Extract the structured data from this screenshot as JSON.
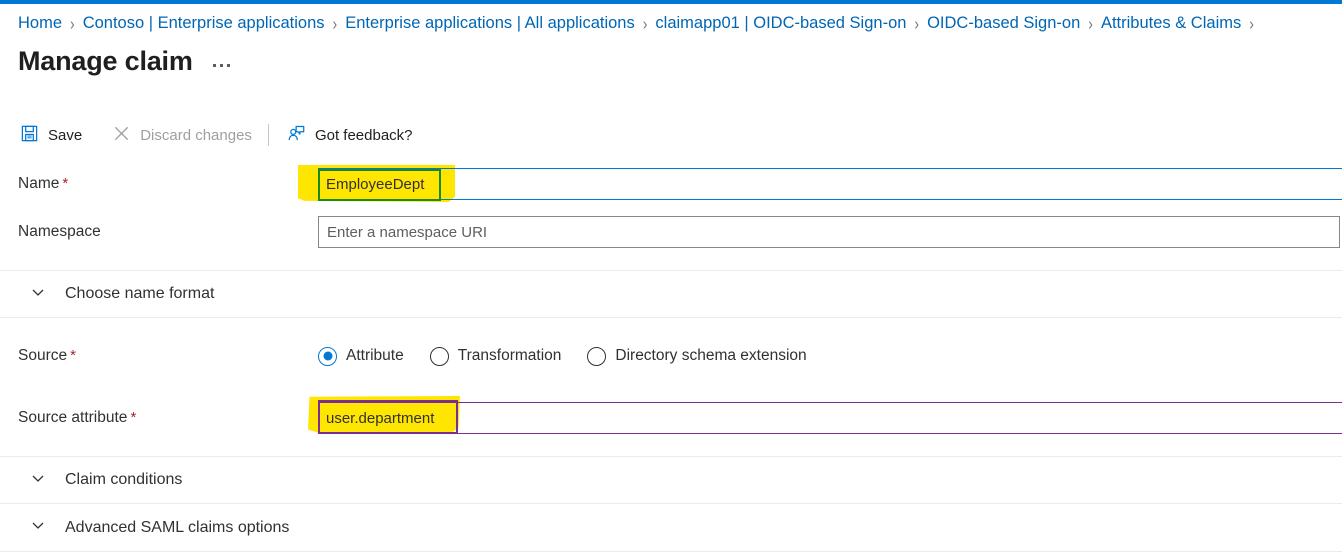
{
  "colors": {
    "accent": "#0078d4",
    "link": "#0066b4",
    "required": "#a4262c",
    "highlight": "#ffe600",
    "annotation_green": "#1a8b1a",
    "annotation_purple": "#7b2d92",
    "disabled_text": "#a19f9d"
  },
  "breadcrumb": {
    "items": [
      "Home",
      "Contoso | Enterprise applications",
      "Enterprise applications | All applications",
      "claimapp01 | OIDC-based Sign-on",
      "OIDC-based Sign-on",
      "Attributes & Claims"
    ],
    "separator": "›",
    "trailing_separator": "›"
  },
  "header": {
    "title": "Manage claim",
    "more_menu": "more-options"
  },
  "toolbar": {
    "save_label": "Save",
    "save_icon": "save-icon",
    "discard_label": "Discard changes",
    "discard_icon": "close-x-icon",
    "discard_disabled": true,
    "feedback_label": "Got feedback?",
    "feedback_icon": "person-feedback-icon"
  },
  "form": {
    "name": {
      "label": "Name",
      "required_marker": "*",
      "value": "EmployeeDept",
      "placeholder": "",
      "annotation": "green-rectangle",
      "highlight": "yellow"
    },
    "namespace": {
      "label": "Namespace",
      "required_marker": "",
      "value": "",
      "placeholder": "Enter a namespace URI"
    },
    "choose_name_format": {
      "label": "Choose name format",
      "expanded": false,
      "icon": "chevron-down-icon"
    },
    "source": {
      "label": "Source",
      "required_marker": "*",
      "options": [
        {
          "label": "Attribute",
          "selected": true
        },
        {
          "label": "Transformation",
          "selected": false
        },
        {
          "label": "Directory schema extension",
          "selected": false
        }
      ]
    },
    "source_attribute": {
      "label": "Source attribute",
      "required_marker": "*",
      "value": "user.department",
      "placeholder": "",
      "annotation": "purple-rectangle",
      "highlight": "yellow"
    },
    "claim_conditions": {
      "label": "Claim conditions",
      "expanded": false,
      "icon": "chevron-down-icon"
    },
    "advanced_saml": {
      "label": "Advanced SAML claims options",
      "expanded": false,
      "icon": "chevron-down-icon"
    }
  }
}
